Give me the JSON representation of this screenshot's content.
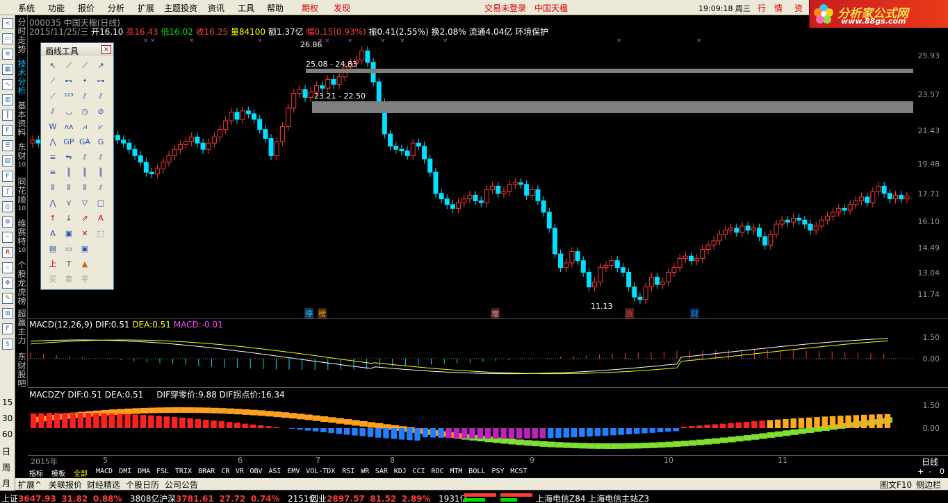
{
  "menu": {
    "items": [
      "系统",
      "功能",
      "报价",
      "分析",
      "扩展",
      "主题投资",
      "资讯",
      "工具",
      "帮助"
    ],
    "quanquan": "期权",
    "faxian": "发现",
    "login": "交易未登录",
    "brand_cn": "中国天楹",
    "clock": "19:09:18 周三",
    "quote_tabs": [
      "行",
      "情",
      "资"
    ]
  },
  "logo": {
    "line1": "分析家公式网",
    "line2": "www.88gs.com"
  },
  "left_toolbar_numbers": [
    "15",
    "30",
    "60",
    "日",
    "周",
    "月"
  ],
  "vertical_tabs": [
    {
      "label": "分时走势",
      "sub": ""
    },
    {
      "label": "技术分析",
      "sub": ""
    },
    {
      "label": "基本资料",
      "sub": ""
    },
    {
      "label": "东财",
      "sub": "10"
    },
    {
      "label": "同花顺",
      "sub": "10"
    },
    {
      "label": "维赛特",
      "sub": "10"
    },
    {
      "label": "个股龙虎榜",
      "sub": ""
    },
    {
      "label": "超赢主力",
      "sub": ""
    },
    {
      "label": "东财股吧",
      "sub": ""
    }
  ],
  "stock": {
    "title": "000035 中国天楹(日线)",
    "date": "2015/11/25/三",
    "open_label": "开",
    "open": "16.10",
    "high_label": "高",
    "high": "16.43",
    "low_label": "低",
    "low": "16.02",
    "close_label": "收",
    "close": "16.25",
    "vol_label": "量",
    "vol": "84100",
    "amt_label": "额",
    "amt": "1.37亿",
    "chg_label": "幅",
    "chg": "0.15(0.93%)",
    "amp_label": "振",
    "amp": "0.41(2.55%)",
    "turn_label": "换",
    "turn": "2.08%",
    "float_label": "流通",
    "float": "4.04亿",
    "concept": "环境保护"
  },
  "price_axis": [
    "25.93",
    "23.57",
    "21.43",
    "19.48",
    "17.71",
    "16.10",
    "14.49",
    "13.04",
    "11.74"
  ],
  "annotations": {
    "peak": "26.86",
    "band1": "25.08 - 24.83",
    "band2": "23.21 - 22.50",
    "bottom": "11.13"
  },
  "event_markers": [
    {
      "text": "停",
      "color": "#00d8ff"
    },
    {
      "text": "榜",
      "color": "#ffaa00"
    },
    {
      "text": "增",
      "color": "#ff6666"
    },
    {
      "text": "涨",
      "color": "#ff3a3a"
    },
    {
      "text": "财",
      "color": "#00a0ff"
    }
  ],
  "palette": {
    "title": "画线工具",
    "close": "×",
    "trade_labels": [
      "买",
      "卖",
      "平"
    ],
    "text_tools": [
      "上",
      "T",
      "A"
    ]
  },
  "macd": {
    "label": "MACD(12,26,9)",
    "dif_label": "DIF:",
    "dif": "0.51",
    "dea_label": "DEA:",
    "dea": "0.51",
    "macd_label": "MACD:",
    "macd": "-0.01",
    "axis": [
      "1.50",
      "0.00"
    ]
  },
  "macdzy": {
    "label": "MACDZY",
    "dif_label": "DIF:",
    "dif": "0.51",
    "dea_label": "DEA:",
    "dea": "0.51",
    "cross_label": "DIF穿零价:",
    "cross": "9.88",
    "turn_label": "DIF拐点价:",
    "turn": "16.34",
    "axis": [
      "1.50",
      "0.00"
    ]
  },
  "date_axis": [
    "2015年",
    "5",
    "6",
    "7",
    "8",
    "9",
    "10",
    "11"
  ],
  "period_label": "日线",
  "indicators": [
    "指标",
    "模板",
    "全部",
    "MACD",
    "DMI",
    "DMA",
    "FSL",
    "TRIX",
    "BRAR",
    "CR",
    "VR",
    "OBV",
    "ASI",
    "EMV",
    "VOL-TDX",
    "RSI",
    "WR",
    "SAR",
    "KDJ",
    "CCI",
    "ROC",
    "MTM",
    "BOLL",
    "PSY",
    "MCST"
  ],
  "right_controls": [
    "+",
    "-",
    "0"
  ],
  "bottom_tabs": [
    "扩展^",
    "关联报价",
    "财经精选",
    "个股日历",
    "公司公告"
  ],
  "bottom_right": [
    "图文F10",
    "侧边栏<"
  ],
  "status": {
    "sh_label": "上证",
    "sh": "3647.93",
    "sh_chg": "31.82",
    "sh_pct": "0.88%",
    "sh_amt": "3808亿",
    "sz_label": "沪深",
    "sz": "3781.61",
    "sz_chg": "27.72",
    "sz_pct": "0.74%",
    "sz_amt": "2151亿",
    "cy_label": "创业",
    "cy": "2897.57",
    "cy_chg": "81.52",
    "cy_pct": "2.89%",
    "cy_amt": "1931亿",
    "server": "上海电信Z84 上海电信主站Z3"
  },
  "colors": {
    "up": "#ff3a3a",
    "down": "#00e0ff",
    "band": "#7f7f7f",
    "dif": "#ffffff",
    "dea": "#ffff00"
  }
}
